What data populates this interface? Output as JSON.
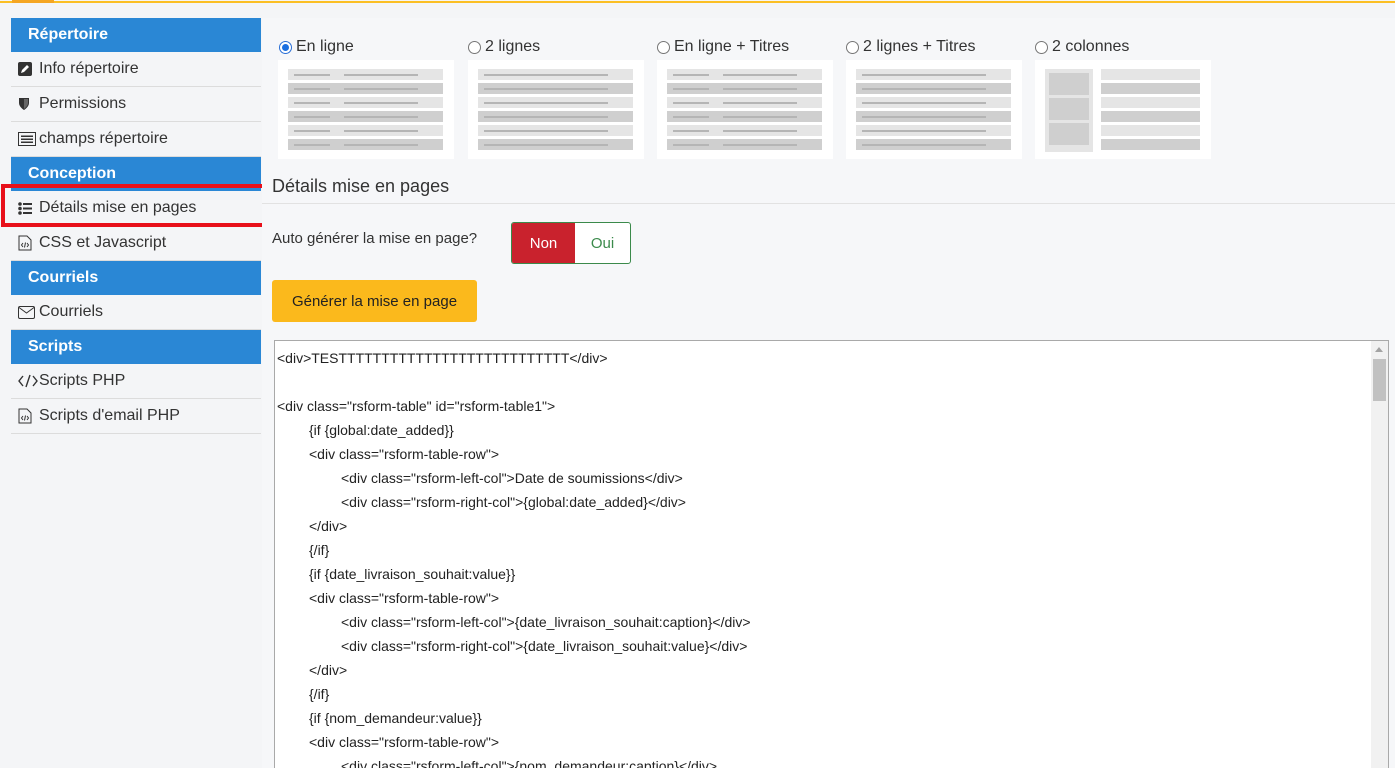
{
  "sidebar": {
    "sections": [
      {
        "label": "Répertoire"
      },
      {
        "label": "Conception"
      },
      {
        "label": "Courriels"
      },
      {
        "label": "Scripts"
      }
    ],
    "items": [
      {
        "label": "Info répertoire",
        "icon": "edit-icon"
      },
      {
        "label": "Permissions",
        "icon": "shield-icon"
      },
      {
        "label": "champs répertoire",
        "icon": "list-form-icon"
      },
      {
        "label": "Détails mise en pages",
        "icon": "list-icon"
      },
      {
        "label": "CSS et Javascript",
        "icon": "code-file-icon"
      },
      {
        "label": "Courriels",
        "icon": "envelope-icon"
      },
      {
        "label": "Scripts PHP",
        "icon": "code-icon"
      },
      {
        "label": "Scripts d'email PHP",
        "icon": "code-file-icon"
      }
    ],
    "highlight_color": "#e8101a"
  },
  "layouts": [
    {
      "label": "En ligne",
      "selected": true
    },
    {
      "label": "2 lignes",
      "selected": false
    },
    {
      "label": "En ligne + Titres",
      "selected": false
    },
    {
      "label": "2 lignes + Titres",
      "selected": false
    },
    {
      "label": "2 colonnes",
      "selected": false
    }
  ],
  "details": {
    "title": "Détails mise en pages",
    "auto_label": "Auto générer la mise en page?",
    "toggle_non": "Non",
    "toggle_oui": "Oui",
    "generate_button": "Générer la mise en page"
  },
  "code_lines": [
    "<div>TESTTTTTTTTTTTTTTTTTTTTTTTTTTT</div>",
    "",
    "<div class=\"rsform-table\" id=\"rsform-table1\">",
    "\t{if {global:date_added}}",
    "\t<div class=\"rsform-table-row\">",
    "\t\t<div class=\"rsform-left-col\">Date de soumissions</div>",
    "\t\t<div class=\"rsform-right-col\">{global:date_added}</div>",
    "\t</div>",
    "\t{/if}",
    "\t{if {date_livraison_souhait:value}}",
    "\t<div class=\"rsform-table-row\">",
    "\t\t<div class=\"rsform-left-col\">{date_livraison_souhait:caption}</div>",
    "\t\t<div class=\"rsform-right-col\">{date_livraison_souhait:value}</div>",
    "\t</div>",
    "\t{/if}",
    "\t{if {nom_demandeur:value}}",
    "\t<div class=\"rsform-table-row\">",
    "\t\t<div class=\"rsform-left-col\">{nom_demandeur:caption}</div>"
  ]
}
